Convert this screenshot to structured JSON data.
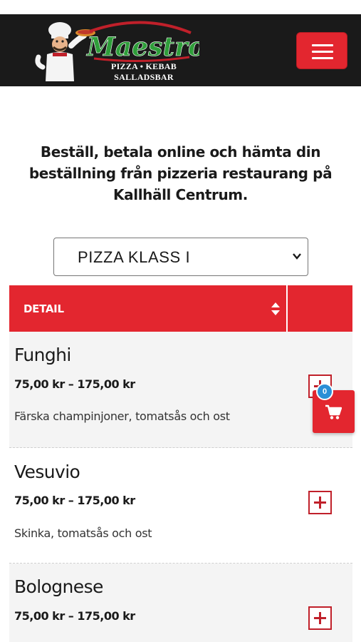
{
  "header": {
    "brand_name": "Maestros",
    "brand_tagline_line1": "PIZZA • KEBAB",
    "brand_tagline_line2": "SALLADSBAR",
    "menu_icon": "hamburger-menu-icon",
    "colors": {
      "bar": "#1a1a1a",
      "accent": "#e3262f",
      "brand_green": "#2f9e3a"
    }
  },
  "intro": {
    "text": "Beställ, betala online och hämta din beställning från pizzeria restaurang på Kallhäll Centrum."
  },
  "category_select": {
    "selected": "PIZZA KLASS I"
  },
  "table": {
    "header_label": "DETAIL",
    "sort_icon": "sort-icon"
  },
  "products": [
    {
      "name": "Funghi",
      "price": "75,00 kr – 175,00 kr",
      "description": "Färska champinjoner, tomatsås och ost"
    },
    {
      "name": "Vesuvio",
      "price": "75,00 kr – 175,00 kr",
      "description": "Skinka, tomatsås och ost"
    },
    {
      "name": "Bolognese",
      "price": "75,00 kr – 175,00 kr",
      "description": ""
    }
  ],
  "cart": {
    "count": "0",
    "icon": "shopping-cart-icon"
  }
}
